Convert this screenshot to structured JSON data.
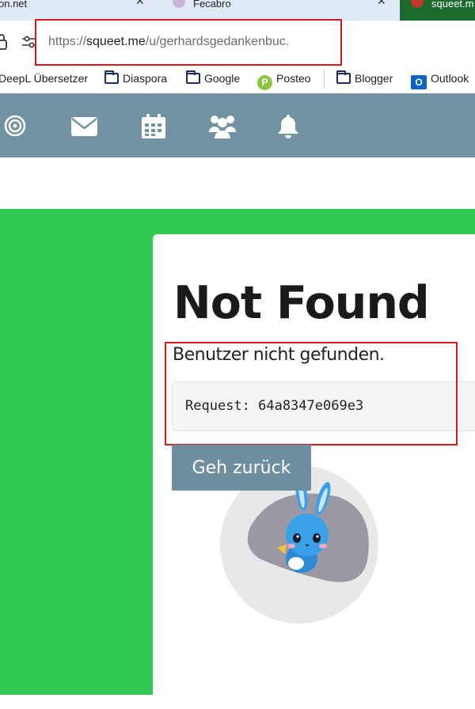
{
  "browser": {
    "tabs": [
      {
        "label": "on.net"
      },
      {
        "label": "Fecabro"
      },
      {
        "label": "squeet.m"
      }
    ],
    "url": {
      "prefix": "https://",
      "host": "squeet.me",
      "path": "/u/gerhardsgedankenbuc."
    },
    "bookmarks": [
      {
        "label": "DeepL Übersetzer"
      },
      {
        "label": "Diaspora"
      },
      {
        "label": "Google"
      },
      {
        "label": "Posteo"
      },
      {
        "label": "Blogger"
      },
      {
        "label": "Outlook"
      }
    ]
  },
  "site_nav": {
    "icons": [
      "target-icon",
      "mail-icon",
      "calendar-icon",
      "people-icon",
      "bell-icon"
    ]
  },
  "error": {
    "title": "Not Found",
    "message": "Benutzer nicht gefunden.",
    "request": "Request: 64a8347e069e3",
    "back_button": "Geh zurück"
  },
  "colors": {
    "nav_bg": "#7292a4",
    "page_bg": "#2fc853",
    "button_bg": "#6f8fa0",
    "highlight": "#d9161e"
  }
}
